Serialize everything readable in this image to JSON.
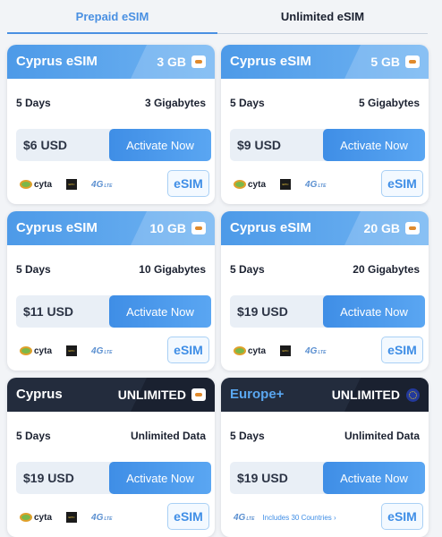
{
  "tabs": [
    {
      "label": "Prepaid eSIM",
      "active": true
    },
    {
      "label": "Unlimited eSIM",
      "active": false
    }
  ],
  "cards": [
    {
      "title": "Cyprus eSIM",
      "size": "3 GB",
      "days": "5 Days",
      "data": "3 Gigabytes",
      "price": "$6 USD",
      "button": "Activate Now",
      "flag": "cyprus-flag-icon",
      "theme": "blue",
      "logos": [
        "cyta",
        "epic",
        "4G LTE"
      ],
      "esim": "eSIM"
    },
    {
      "title": "Cyprus eSIM",
      "size": "5 GB",
      "days": "5 Days",
      "data": "5 Gigabytes",
      "price": "$9 USD",
      "button": "Activate Now",
      "flag": "cyprus-flag-icon",
      "theme": "blue",
      "logos": [
        "cyta",
        "epic",
        "4G LTE"
      ],
      "esim": "eSIM"
    },
    {
      "title": "Cyprus eSIM",
      "size": "10 GB",
      "days": "5 Days",
      "data": "10 Gigabytes",
      "price": "$11 USD",
      "button": "Activate Now",
      "flag": "cyprus-flag-icon",
      "theme": "blue",
      "logos": [
        "cyta",
        "epic",
        "4G LTE"
      ],
      "esim": "eSIM"
    },
    {
      "title": "Cyprus eSIM",
      "size": "20 GB",
      "days": "5 Days",
      "data": "20 Gigabytes",
      "price": "$19 USD",
      "button": "Activate Now",
      "flag": "cyprus-flag-icon",
      "theme": "blue",
      "logos": [
        "cyta",
        "epic",
        "4G LTE"
      ],
      "esim": "eSIM"
    },
    {
      "title": "Cyprus",
      "size": "UNLIMITED",
      "days": "5 Days",
      "data": "Unlimited Data",
      "price": "$19 USD",
      "button": "Activate Now",
      "flag": "cyprus-flag-icon",
      "theme": "dark",
      "logos": [
        "cyta",
        "epic",
        "4G LTE"
      ],
      "esim": "eSIM"
    },
    {
      "title": "Europe+",
      "size": "UNLIMITED",
      "days": "5 Days",
      "data": "Unlimited Data",
      "price": "$19 USD",
      "button": "Activate Now",
      "flag": "eu-flag-icon",
      "theme": "dark",
      "logos": [
        "4G LTE"
      ],
      "includes": "Includes 30 Countries ›",
      "esim": "eSIM"
    }
  ],
  "logo_text": {
    "cyta": "cyta",
    "epic": "EPIC",
    "lte_main": "4G",
    "lte_sub": "LTE"
  },
  "colors": {
    "accent": "#4a90e2",
    "header_blue": "#4d9ae8",
    "header_dark": "#232c3d",
    "text": "#1b2130"
  }
}
